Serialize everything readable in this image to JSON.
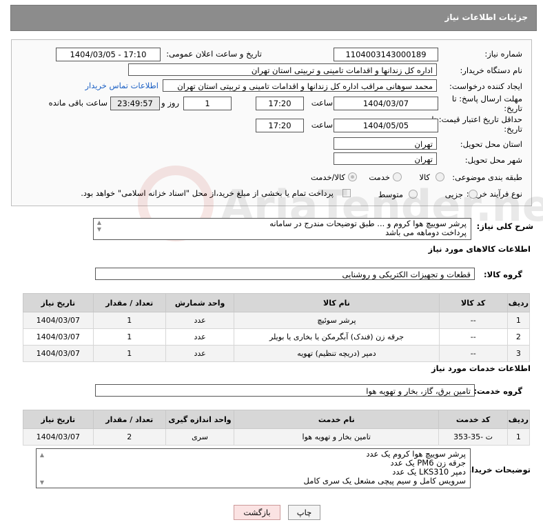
{
  "header": {
    "title": "جزئیات اطلاعات نیاز"
  },
  "form": {
    "need_number_label": "شماره نیاز:",
    "need_number": "1104003143000189",
    "announce_label": "تاریخ و ساعت اعلان عمومی:",
    "announce_value": "1404/03/05 - 17:10",
    "buyer_org_label": "نام دستگاه خریدار:",
    "buyer_org": "اداره کل زندانها و اقدامات تامینی و تربیتی استان تهران",
    "requester_label": "ایجاد کننده درخواست:",
    "requester": "محمد سوهانی مراقب  اداره کل زندانها و اقدامات تامینی و تربیتی استان تهران",
    "contact_link": "اطلاعات تماس خریدار",
    "deadline_label": "مهلت ارسال پاسخ: تا تاریخ:",
    "deadline_date": "1404/03/07",
    "time_label": "ساعت",
    "deadline_time": "17:20",
    "days_value": "1",
    "days_label": "روز و",
    "remaining_time": "23:49:57",
    "remaining_label": "ساعت باقی مانده",
    "validity_label": "حداقل تاریخ اعتبار قیمت: تا تاریخ:",
    "validity_date": "1404/05/05",
    "validity_time": "17:20",
    "province_label": "استان محل تحویل:",
    "province": "تهران",
    "city_label": "شهر محل تحویل:",
    "city": "تهران",
    "category_label": "طبقه بندی موضوعی:",
    "category_options": [
      "کالا",
      "خدمت",
      "کالا/خدمت"
    ],
    "purchase_type_label": "نوع فرآیند خرید :",
    "purchase_options": [
      "جزیی",
      "متوسط"
    ],
    "payment_note": "پرداخت تمام یا بخشی از مبلغ خرید،از محل \"اسناد خزانه اسلامی\" خواهد بود."
  },
  "summary": {
    "label": "شرح کلی نیاز:",
    "lines": [
      "پرشر سوییچ هوا کروم و ... طبق توضیحات مندرج در سامانه",
      "پرداخت دوماهه می باشد"
    ]
  },
  "goods": {
    "section_title": "اطلاعات کالاهای مورد نیاز",
    "group_label": "گروه کالا:",
    "group_value": "قطعات و تجهیزات الکتریکی و روشنایی",
    "columns": [
      "ردیف",
      "کد کالا",
      "نام کالا",
      "واحد شمارش",
      "تعداد / مقدار",
      "تاریخ نیاز"
    ],
    "rows": [
      [
        "1",
        "--",
        "پرشر سوئیچ",
        "عدد",
        "1",
        "1404/03/07"
      ],
      [
        "2",
        "--",
        "جرقه زن (فندک) آبگرمکن یا بخاری یا بویلر",
        "عدد",
        "1",
        "1404/03/07"
      ],
      [
        "3",
        "--",
        "دمپر (دریچه تنظیم) تهویه",
        "عدد",
        "1",
        "1404/03/07"
      ]
    ]
  },
  "services": {
    "section_title": "اطلاعات خدمات مورد نیاز",
    "group_label": "گروه خدمت:",
    "group_value": "تامین برق، گاز، بخار و تهویه هوا",
    "columns": [
      "ردیف",
      "کد خدمت",
      "نام خدمت",
      "واحد اندازه گیری",
      "تعداد / مقدار",
      "تاریخ نیاز"
    ],
    "rows": [
      [
        "1",
        "ت -35-353",
        "تامین بخار و تهویه هوا",
        "سری",
        "2",
        "1404/03/07"
      ]
    ]
  },
  "buyer_notes": {
    "label": "توضیحات خریدار:",
    "lines": [
      "پرشر سوییچ هوا کروم یک عدد",
      "جرقه زن PM6 یک عدد",
      "دمپر LKS310 یک عدد",
      "سرویس کامل و سیم پیچی مشعل یک سری کامل"
    ]
  },
  "buttons": {
    "print": "چاپ",
    "back": "بازگشت"
  },
  "watermark": "AriaTender.neT"
}
